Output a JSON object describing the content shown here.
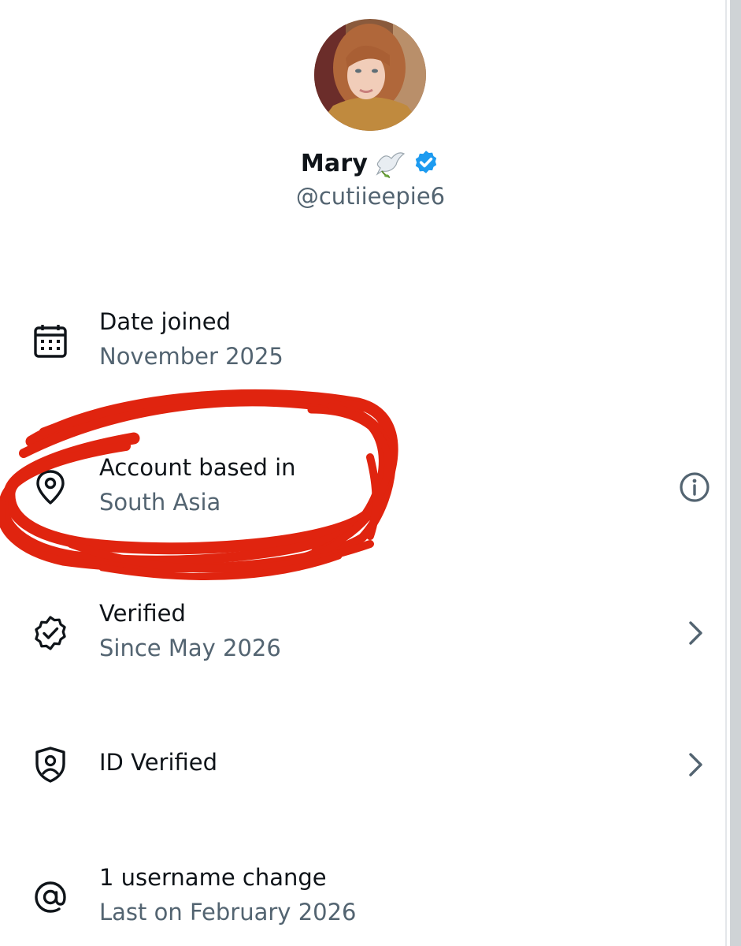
{
  "profile": {
    "name": "Mary",
    "handle": "@cutiieepie6",
    "avatar_icon": "profile-photo",
    "name_emoji_icon": "dove-icon",
    "verified_badge_color": "#1d9bf0"
  },
  "about_rows": [
    {
      "icon": "calendar-icon",
      "title": "Date joined",
      "subtitle": "November 2025",
      "trailing": "none"
    },
    {
      "icon": "location-pin-icon",
      "title": "Account based in",
      "subtitle": "South Asia",
      "trailing": "info-icon"
    },
    {
      "icon": "verified-seal-icon",
      "title": "Verified",
      "subtitle": "Since May 2026",
      "trailing": "chevron-right-icon"
    },
    {
      "icon": "id-shield-icon",
      "title": "ID Verified",
      "subtitle": "",
      "trailing": "chevron-right-icon"
    },
    {
      "icon": "at-sign-icon",
      "title": "1 username change",
      "subtitle": "Last on February 2026",
      "trailing": "none"
    }
  ],
  "annotation": {
    "type": "hand-drawn-circle",
    "color": "#e0240f",
    "target": "Account based in"
  },
  "colors": {
    "primary_text": "#0f1419",
    "secondary_text": "#536471",
    "background": "#ffffff"
  }
}
